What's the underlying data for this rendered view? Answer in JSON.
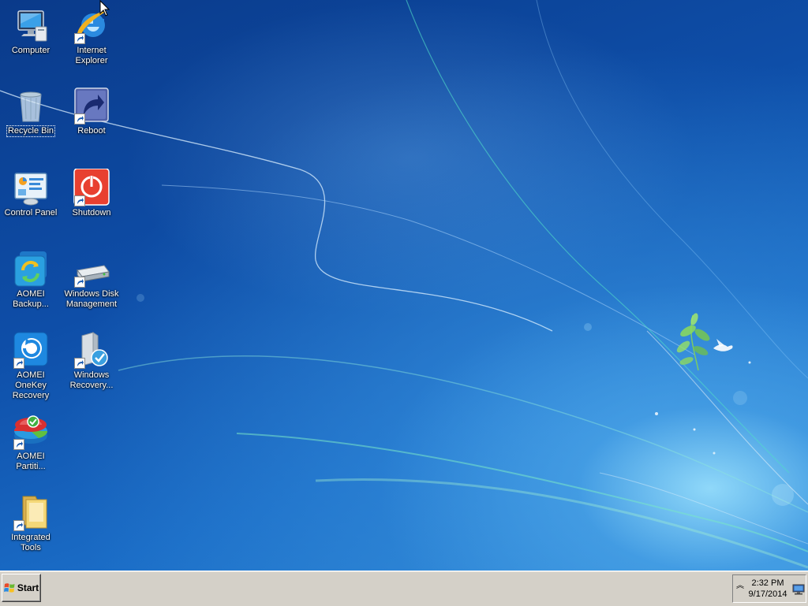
{
  "desktop": {
    "icons": [
      {
        "name": "computer",
        "label": "Computer",
        "shortcut": false,
        "selected": false
      },
      {
        "name": "internet-explorer",
        "label": "Internet\nExplorer",
        "shortcut": true,
        "selected": false
      },
      {
        "name": "recycle-bin",
        "label": "Recycle Bin",
        "shortcut": false,
        "selected": true
      },
      {
        "name": "reboot",
        "label": "Reboot",
        "shortcut": true,
        "selected": false
      },
      {
        "name": "control-panel",
        "label": "Control Panel",
        "shortcut": false,
        "selected": false
      },
      {
        "name": "shutdown",
        "label": "Shutdown",
        "shortcut": true,
        "selected": false
      },
      {
        "name": "aomei-backupper",
        "label": "AOMEI\nBackup...",
        "shortcut": false,
        "selected": false
      },
      {
        "name": "windows-disk-management",
        "label": "Windows Disk\nManagement",
        "shortcut": true,
        "selected": false
      },
      {
        "name": "aomei-onekey-recovery",
        "label": "AOMEI OneKey\nRecovery",
        "shortcut": true,
        "selected": false
      },
      {
        "name": "windows-recovery",
        "label": "Windows\nRecovery...",
        "shortcut": true,
        "selected": false
      },
      {
        "name": "aomei-partition",
        "label": "AOMEI\nPartiti...",
        "shortcut": true,
        "selected": false
      },
      {
        "name": "integrated-tools",
        "label": "Integrated\nTools",
        "shortcut": true,
        "selected": false
      }
    ]
  },
  "taskbar": {
    "start_label": "Start",
    "tray": {
      "expand_glyph": "︽",
      "time": "2:32 PM",
      "date": "9/17/2014",
      "network_icon": "network-monitor-icon"
    }
  },
  "colors": {
    "taskbar": "#d4d0c8",
    "desktop_dark": "#0a3a8a",
    "desktop_light": "#2e88d6",
    "label_text": "#ffffff"
  }
}
